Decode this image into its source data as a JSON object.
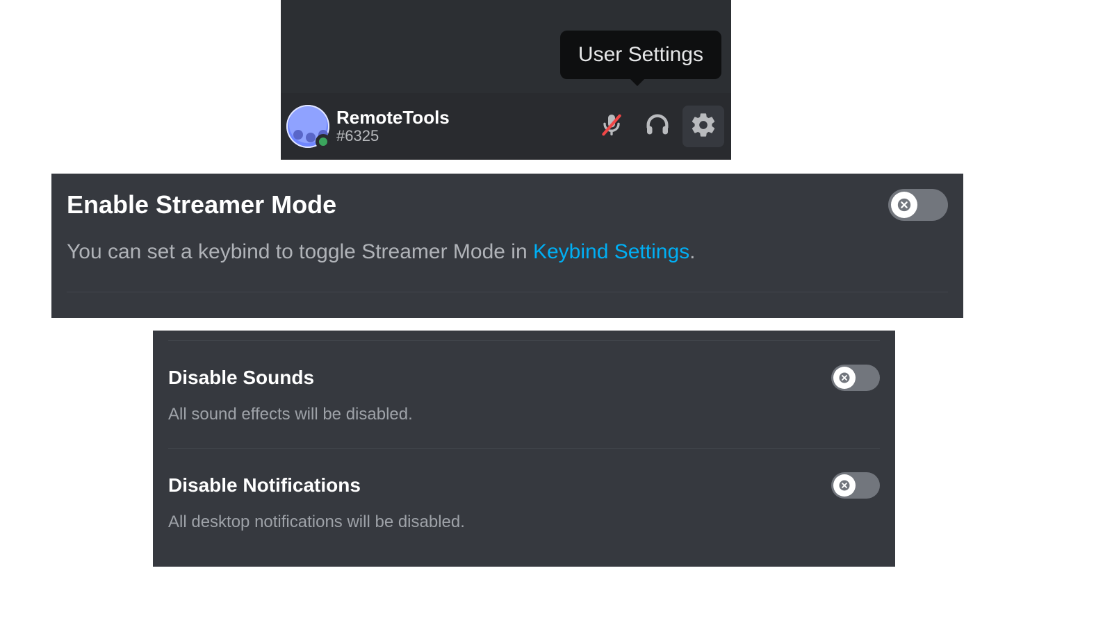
{
  "colors": {
    "panel_bg": "#36393f",
    "bar_bg": "#292b2f",
    "tooltip_bg": "#0e0f10",
    "text_primary": "#ffffff",
    "text_secondary": "#b0b3b8",
    "link": "#00aff4",
    "toggle_off": "#72767d",
    "status_online": "#3ba55d"
  },
  "tooltip": {
    "text": "User Settings"
  },
  "user": {
    "name": "RemoteTools",
    "tag": "#6325",
    "status": "online"
  },
  "icons": {
    "mic": "mic-muted-icon",
    "headphones": "headphones-icon",
    "gear": "gear-icon"
  },
  "settings": {
    "streamer": {
      "title": "Enable Streamer Mode",
      "desc_prefix": "You can set a keybind to toggle Streamer Mode in ",
      "link_text": "Keybind Settings",
      "desc_suffix": ".",
      "enabled": false
    },
    "sounds": {
      "title": "Disable Sounds",
      "desc": "All sound effects will be disabled.",
      "enabled": false
    },
    "notifications": {
      "title": "Disable Notifications",
      "desc": "All desktop notifications will be disabled.",
      "enabled": false
    }
  }
}
